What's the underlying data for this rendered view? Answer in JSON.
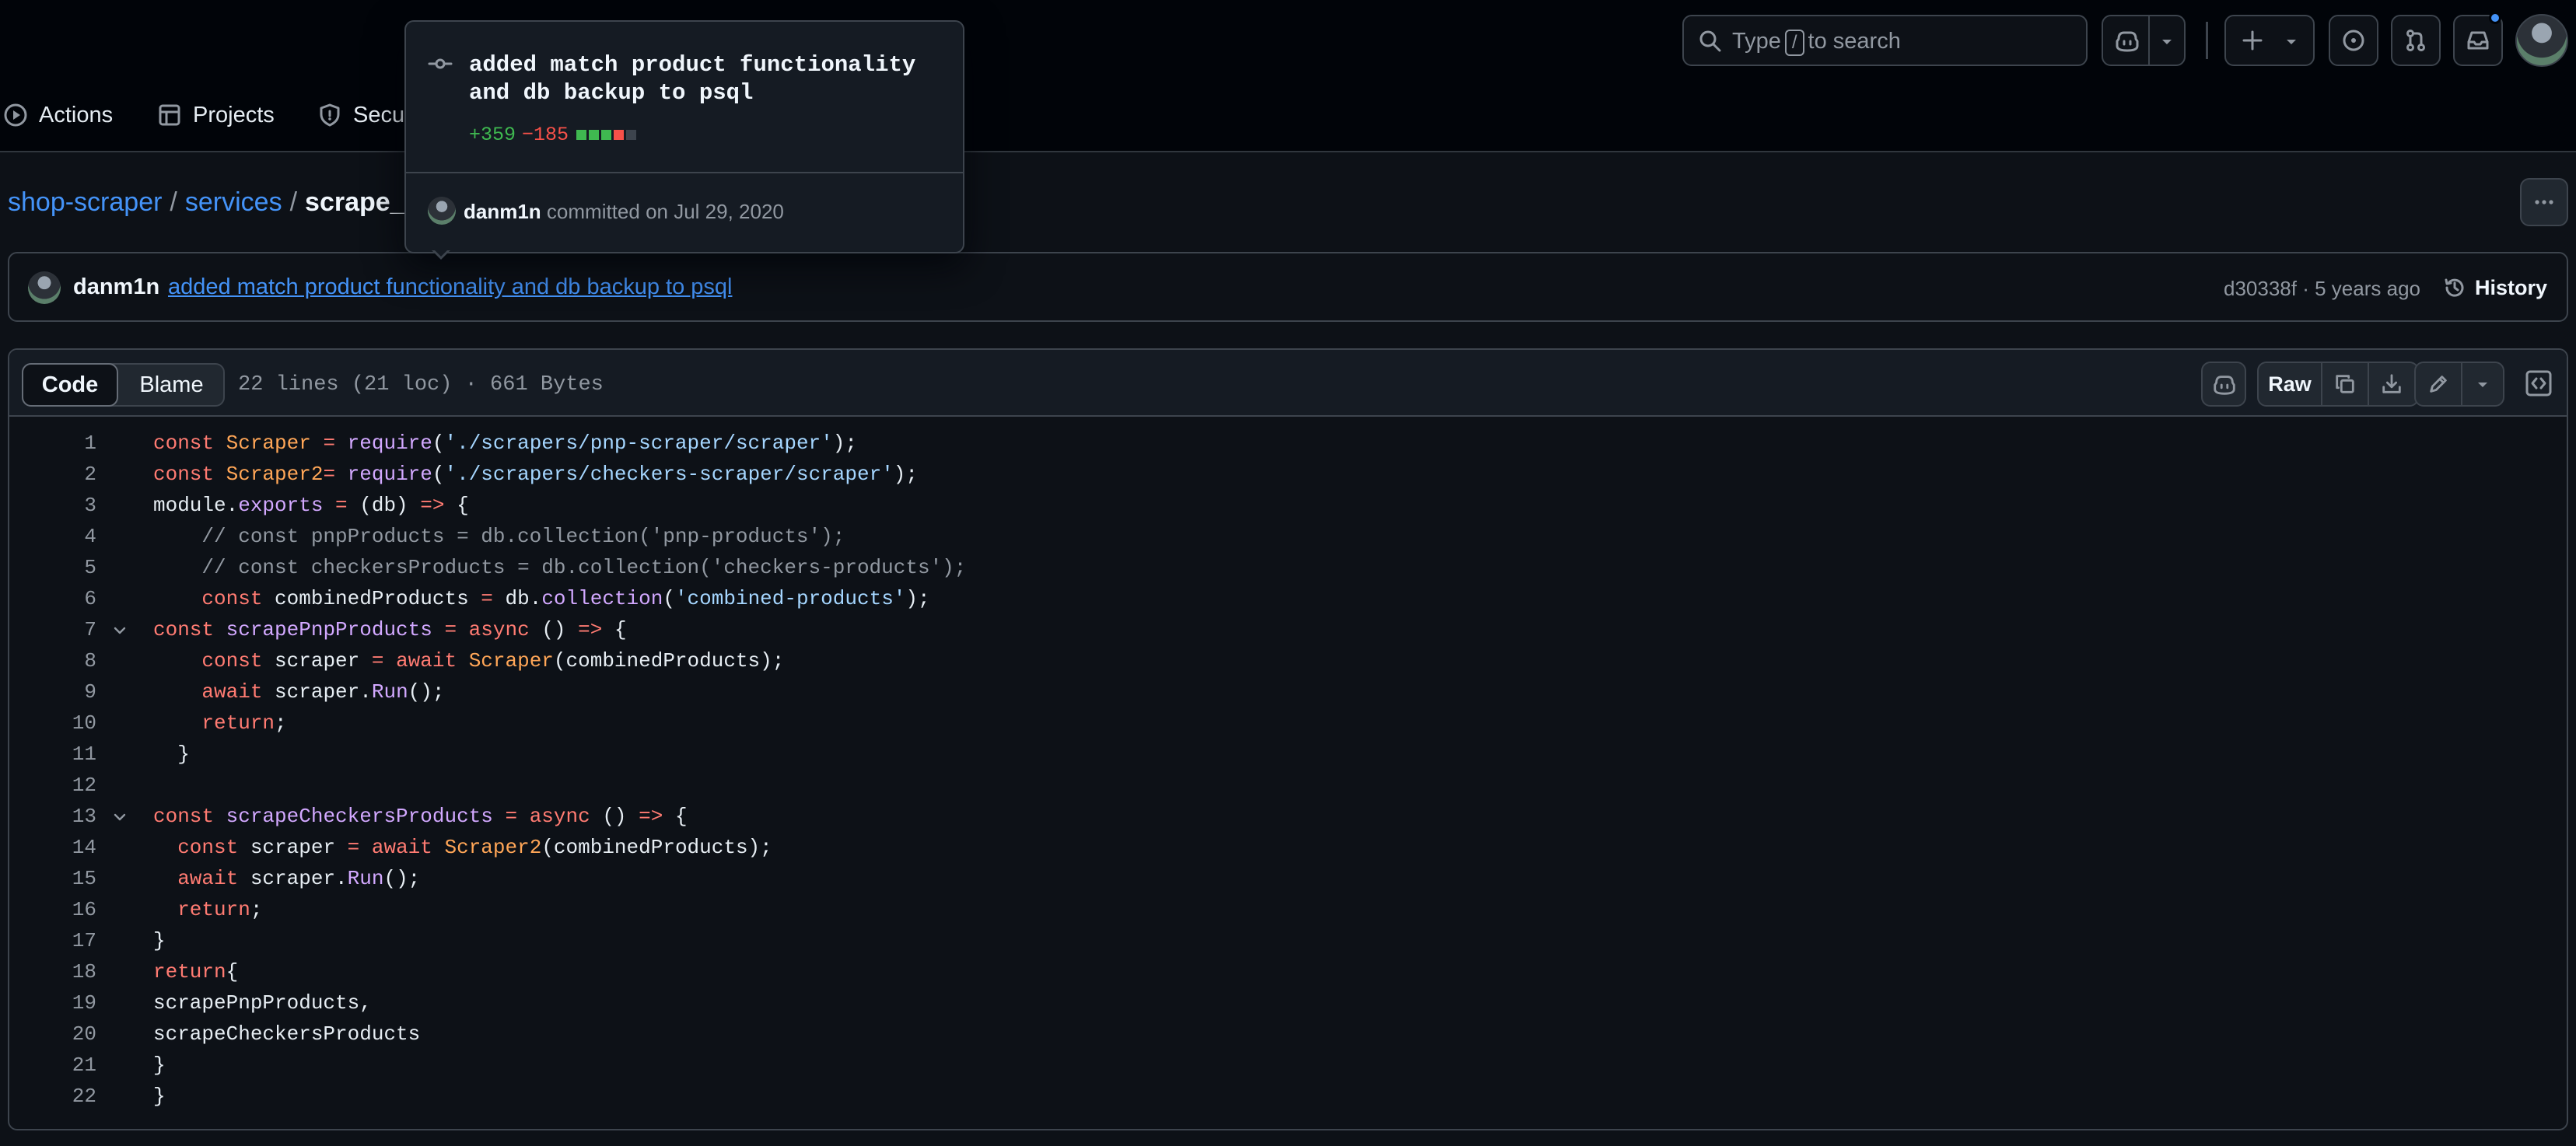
{
  "colors": {
    "link": "#4493f8",
    "addition": "#3fb950",
    "deletion": "#f85149",
    "notification": "#4493f8"
  },
  "header": {
    "search": {
      "before": "Type",
      "key": "/",
      "after": "to search"
    },
    "icons": [
      "copilot-icon",
      "chevron-down-icon",
      "plus-icon",
      "issue-icon",
      "pull-request-icon",
      "inbox-icon",
      "avatar"
    ]
  },
  "repo_nav": {
    "items": [
      {
        "label": "Actions",
        "icon": "play-icon"
      },
      {
        "label": "Projects",
        "icon": "table-icon"
      },
      {
        "label": "Secu",
        "icon": "shield-icon"
      }
    ]
  },
  "breadcrumb": {
    "repo": "shop-scraper",
    "folder": "services",
    "file": "scrape_s"
  },
  "commit": {
    "author": "danm1n",
    "message": "added match product functionality and db backup to psql",
    "sha": "d30338f",
    "separator": "·",
    "time": "5 years ago",
    "history_label": "History"
  },
  "popover": {
    "message": "added match product functionality and db backup to psql",
    "additions": "+359",
    "deletions": "−185",
    "diffstat": [
      "add",
      "add",
      "add",
      "del",
      "neutral"
    ],
    "author": "danm1n",
    "committed_text": "committed on Jul 29, 2020"
  },
  "file": {
    "tabs": {
      "code": "Code",
      "blame": "Blame"
    },
    "meta": "22 lines (21 loc) · 661 Bytes",
    "raw_label": "Raw",
    "lines": [
      {
        "n": "1",
        "fold": false,
        "tokens": [
          [
            "kw",
            "const "
          ],
          [
            "var",
            "Scraper"
          ],
          [
            "kw",
            " = "
          ],
          [
            "fn",
            "require"
          ],
          [
            "plain",
            "("
          ],
          [
            "str",
            "'./scrapers/pnp-scraper/scraper'"
          ],
          [
            "plain",
            ");"
          ]
        ]
      },
      {
        "n": "2",
        "fold": false,
        "tokens": [
          [
            "kw",
            "const "
          ],
          [
            "var",
            "Scraper2"
          ],
          [
            "kw",
            "= "
          ],
          [
            "fn",
            "require"
          ],
          [
            "plain",
            "("
          ],
          [
            "str",
            "'./scrapers/checkers-scraper/scraper'"
          ],
          [
            "plain",
            ");"
          ]
        ]
      },
      {
        "n": "3",
        "fold": false,
        "tokens": [
          [
            "plain",
            "module."
          ],
          [
            "fn",
            "exports"
          ],
          [
            "kw",
            " = "
          ],
          [
            "plain",
            "(db) "
          ],
          [
            "kw",
            "=>"
          ],
          [
            "plain",
            " {"
          ]
        ]
      },
      {
        "n": "4",
        "fold": false,
        "tokens": [
          [
            "cmt",
            "    // const pnpProducts = db.collection('pnp-products');"
          ]
        ]
      },
      {
        "n": "5",
        "fold": false,
        "tokens": [
          [
            "cmt",
            "    // const checkersProducts = db.collection('checkers-products');"
          ]
        ]
      },
      {
        "n": "6",
        "fold": false,
        "tokens": [
          [
            "kw",
            "    const "
          ],
          [
            "plain",
            "combinedProducts "
          ],
          [
            "kw",
            "="
          ],
          [
            "plain",
            " db."
          ],
          [
            "fn",
            "collection"
          ],
          [
            "plain",
            "("
          ],
          [
            "str",
            "'combined-products'"
          ],
          [
            "plain",
            ");"
          ]
        ]
      },
      {
        "n": "7",
        "fold": true,
        "tokens": [
          [
            "kw",
            "const "
          ],
          [
            "fn",
            "scrapePnpProducts"
          ],
          [
            "kw",
            " = async "
          ],
          [
            "plain",
            "() "
          ],
          [
            "kw",
            "=>"
          ],
          [
            "plain",
            " {"
          ]
        ]
      },
      {
        "n": "8",
        "fold": false,
        "tokens": [
          [
            "kw",
            "    const "
          ],
          [
            "plain",
            "scraper "
          ],
          [
            "kw",
            "= await "
          ],
          [
            "var",
            "Scraper"
          ],
          [
            "plain",
            "(combinedProducts);"
          ]
        ]
      },
      {
        "n": "9",
        "fold": false,
        "tokens": [
          [
            "kw",
            "    await "
          ],
          [
            "plain",
            "scraper."
          ],
          [
            "fn",
            "Run"
          ],
          [
            "plain",
            "();"
          ]
        ]
      },
      {
        "n": "10",
        "fold": false,
        "tokens": [
          [
            "kw",
            "    return"
          ],
          [
            "plain",
            ";"
          ]
        ]
      },
      {
        "n": "11",
        "fold": false,
        "tokens": [
          [
            "plain",
            "  }"
          ]
        ]
      },
      {
        "n": "12",
        "fold": false,
        "tokens": [
          [
            "plain",
            ""
          ]
        ]
      },
      {
        "n": "13",
        "fold": true,
        "tokens": [
          [
            "kw",
            "const "
          ],
          [
            "fn",
            "scrapeCheckersProducts"
          ],
          [
            "kw",
            " = async "
          ],
          [
            "plain",
            "() "
          ],
          [
            "kw",
            "=>"
          ],
          [
            "plain",
            " {"
          ]
        ]
      },
      {
        "n": "14",
        "fold": false,
        "tokens": [
          [
            "kw",
            "  const "
          ],
          [
            "plain",
            "scraper "
          ],
          [
            "kw",
            "= await "
          ],
          [
            "var",
            "Scraper2"
          ],
          [
            "plain",
            "(combinedProducts);"
          ]
        ]
      },
      {
        "n": "15",
        "fold": false,
        "tokens": [
          [
            "kw",
            "  await "
          ],
          [
            "plain",
            "scraper."
          ],
          [
            "fn",
            "Run"
          ],
          [
            "plain",
            "();"
          ]
        ]
      },
      {
        "n": "16",
        "fold": false,
        "tokens": [
          [
            "kw",
            "  return"
          ],
          [
            "plain",
            ";"
          ]
        ]
      },
      {
        "n": "17",
        "fold": false,
        "tokens": [
          [
            "plain",
            "}"
          ]
        ]
      },
      {
        "n": "18",
        "fold": false,
        "tokens": [
          [
            "kw",
            "return"
          ],
          [
            "plain",
            "{"
          ]
        ]
      },
      {
        "n": "19",
        "fold": false,
        "tokens": [
          [
            "plain",
            "scrapePnpProducts,"
          ]
        ]
      },
      {
        "n": "20",
        "fold": false,
        "tokens": [
          [
            "plain",
            "scrapeCheckersProducts"
          ]
        ]
      },
      {
        "n": "21",
        "fold": false,
        "tokens": [
          [
            "plain",
            "}"
          ]
        ]
      },
      {
        "n": "22",
        "fold": false,
        "tokens": [
          [
            "plain",
            "}"
          ]
        ]
      }
    ]
  }
}
